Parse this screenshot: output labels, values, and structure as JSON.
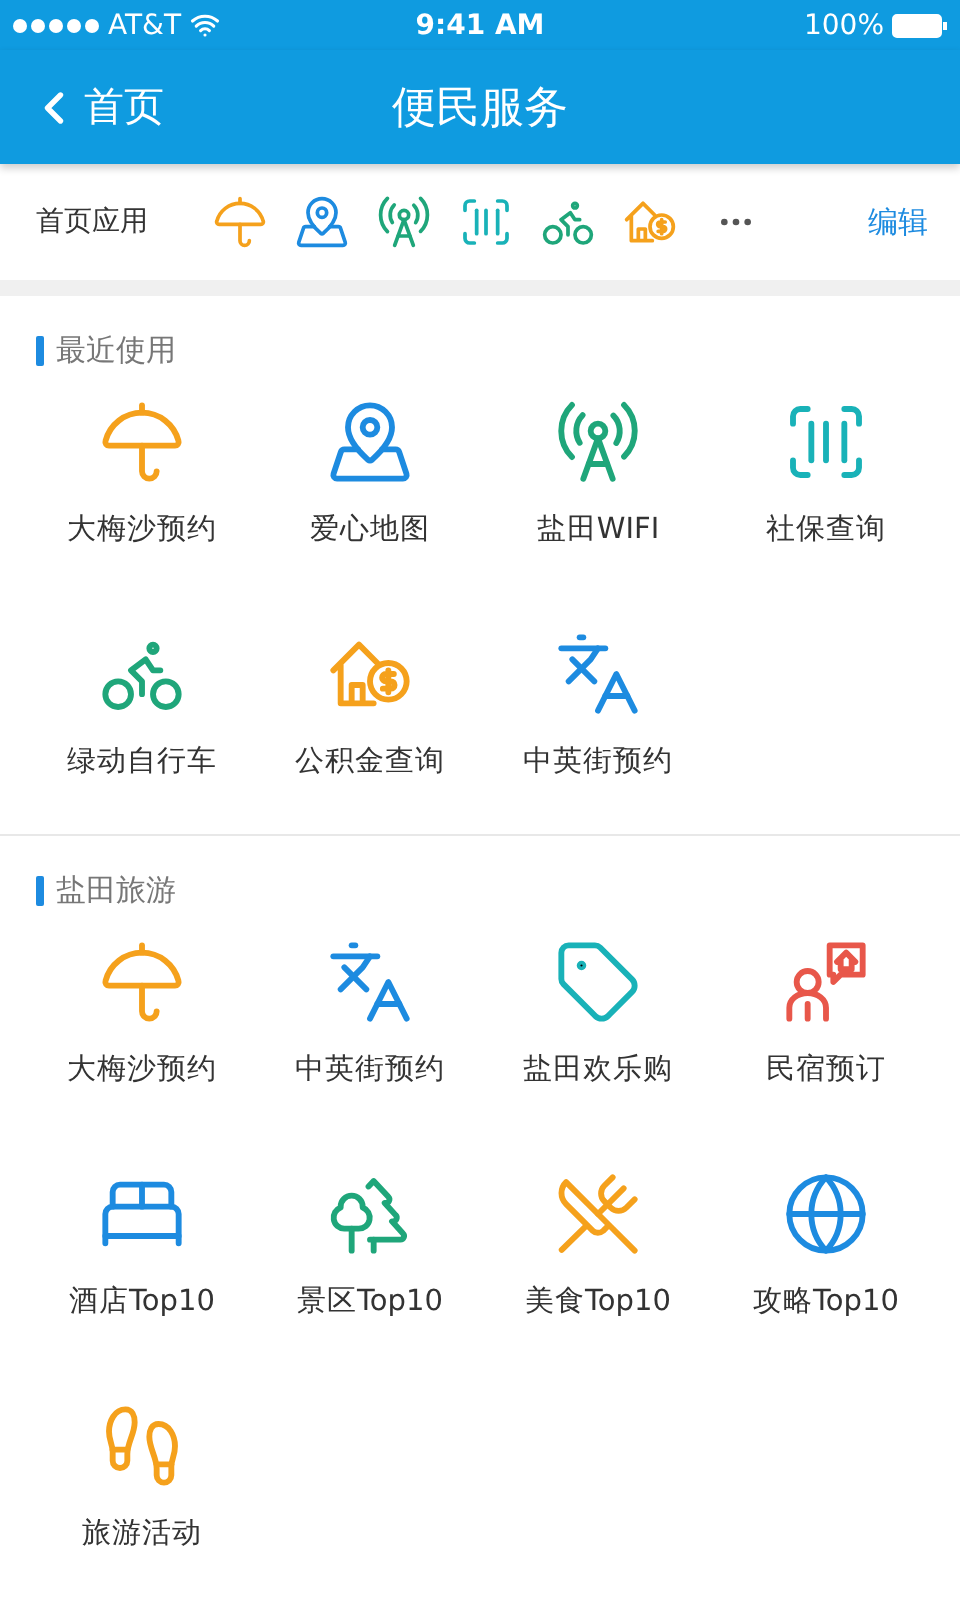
{
  "status_bar": {
    "carrier": "AT&T",
    "time": "9:41 AM",
    "battery": "100%"
  },
  "nav": {
    "back": "首页",
    "title": "便民服务"
  },
  "quick_bar": {
    "label": "首页应用",
    "icons": [
      {
        "kind": "beach",
        "color": "#f5a11c"
      },
      {
        "kind": "map",
        "color": "#1d8be0"
      },
      {
        "kind": "tower",
        "color": "#1fa67a"
      },
      {
        "kind": "barcode",
        "color": "#19b2b8"
      },
      {
        "kind": "bike",
        "color": "#1fa67a"
      },
      {
        "kind": "house",
        "color": "#f5a11c"
      }
    ],
    "edit": "编辑"
  },
  "sections": [
    {
      "title": "最近使用",
      "items": [
        {
          "label": "大梅沙预约",
          "kind": "beach",
          "color": "#f5a11c"
        },
        {
          "label": "爱心地图",
          "kind": "map",
          "color": "#1d8be0"
        },
        {
          "label": "盐田WIFI",
          "kind": "tower",
          "color": "#1fa67a"
        },
        {
          "label": "社保查询",
          "kind": "barcode",
          "color": "#19b2b8"
        },
        {
          "label": "绿动自行车",
          "kind": "bike",
          "color": "#1fa67a"
        },
        {
          "label": "公积金查询",
          "kind": "house",
          "color": "#f5a11c"
        },
        {
          "label": "中英街预约",
          "kind": "translate",
          "color": "#1d8be0"
        }
      ]
    },
    {
      "title": "盐田旅游",
      "items": [
        {
          "label": "大梅沙预约",
          "kind": "beach",
          "color": "#f5a11c"
        },
        {
          "label": "中英街预约",
          "kind": "translate",
          "color": "#1d8be0"
        },
        {
          "label": "盐田欢乐购",
          "kind": "tag",
          "color": "#19b2b8"
        },
        {
          "label": "民宿预订",
          "kind": "homestay",
          "color": "#e8574a"
        },
        {
          "label": "酒店Top10",
          "kind": "bed",
          "color": "#1d8be0"
        },
        {
          "label": "景区Top10",
          "kind": "trees",
          "color": "#1fa67a"
        },
        {
          "label": "美食Top10",
          "kind": "food",
          "color": "#f5a11c"
        },
        {
          "label": "攻略Top10",
          "kind": "globe",
          "color": "#1d8be0"
        },
        {
          "label": "旅游活动",
          "kind": "feet",
          "color": "#f5a11c"
        }
      ]
    }
  ]
}
